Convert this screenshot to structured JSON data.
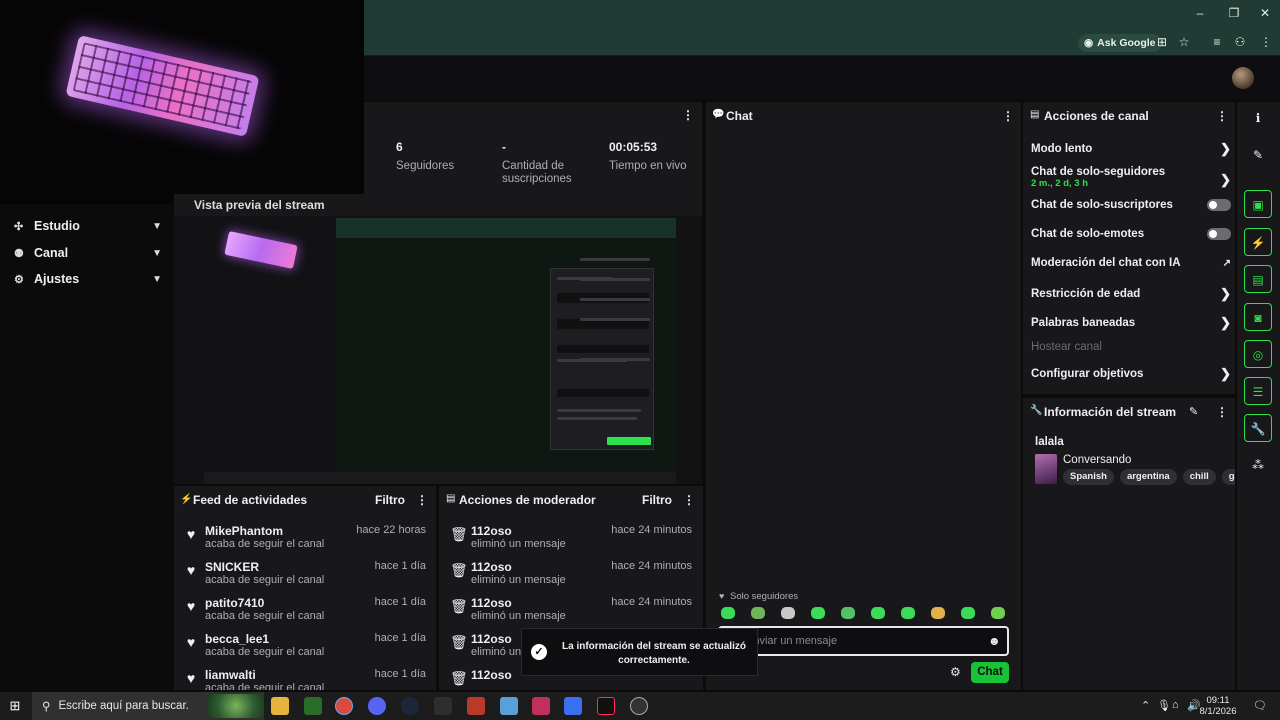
{
  "browser": {
    "ask_google": "Ask Google",
    "controls": {
      "minimize": "‒",
      "maximize": "❐",
      "close": "✕"
    }
  },
  "sidebar": {
    "items": [
      {
        "label": "Estudio"
      },
      {
        "label": "Canal"
      },
      {
        "label": "Ajustes"
      }
    ]
  },
  "stats": {
    "followers_value": "6",
    "followers_label": "Seguidores",
    "subs_value": "-",
    "subs_label": "Cantidad de suscripciones",
    "live_value": "00:05:53",
    "live_label": "Tiempo en vivo"
  },
  "preview": {
    "title": "Vista previa del stream"
  },
  "activity": {
    "title": "Feed de actividades",
    "filter": "Filtro",
    "items": [
      {
        "name": "MikePhantom",
        "action": "acaba de seguir el canal",
        "time": "hace 22 horas"
      },
      {
        "name": "SNICKER",
        "action": "acaba de seguir el canal",
        "time": "hace 1 día"
      },
      {
        "name": "patito7410",
        "action": "acaba de seguir el canal",
        "time": "hace 1 día"
      },
      {
        "name": "becca_lee1",
        "action": "acaba de seguir el canal",
        "time": "hace 1 día"
      },
      {
        "name": "liamwalti",
        "action": "acaba de seguir el canal",
        "time": "hace 1 día"
      }
    ]
  },
  "moderator": {
    "title": "Acciones de moderador",
    "filter": "Filtro",
    "items": [
      {
        "name": "112oso",
        "action": "eliminó un mensaje",
        "time": "hace 24 minutos"
      },
      {
        "name": "112oso",
        "action": "eliminó un mensaje",
        "time": "hace 24 minutos"
      },
      {
        "name": "112oso",
        "action": "eliminó un mensaje",
        "time": "hace 24 minutos"
      },
      {
        "name": "112oso",
        "action": "eliminó un mensaje",
        "time": ""
      },
      {
        "name": "112oso",
        "action": "",
        "time": ""
      }
    ]
  },
  "chat": {
    "title": "Chat",
    "followers_only": "Solo seguidores",
    "placeholder": "Enviar un mensaje",
    "send": "Chat"
  },
  "actions": {
    "title": "Acciones de canal",
    "slow_mode": "Modo lento",
    "followers_chat": "Chat de solo-seguidores",
    "followers_chat_sub": "2 m., 2 d, 3 h",
    "subs_chat": "Chat de solo-suscriptores",
    "emotes_chat": "Chat de solo-emotes",
    "ai_moderation": "Moderación del chat con IA",
    "age_restriction": "Restricción de edad",
    "banned_words": "Palabras baneadas",
    "host_channel": "Hostear canal",
    "goals": "Configurar objetivos"
  },
  "info": {
    "title": "Información del stream",
    "stream_title": "lalala",
    "category": "Conversando",
    "tags": [
      "Spanish",
      "argentina",
      "chill",
      "gaming"
    ]
  },
  "toast": {
    "message": "La información del stream se actualizó correctamente."
  },
  "taskbar": {
    "search": "Escribe aquí para buscar.",
    "time": "09:11",
    "date": "8/1/2026"
  },
  "colors": {
    "accent": "#18c435",
    "panel": "#18181b",
    "browser": "#1f3b33"
  }
}
